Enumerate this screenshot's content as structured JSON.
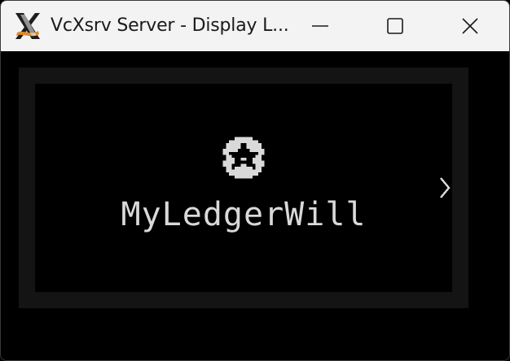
{
  "window": {
    "title": "VcXsrv Server - Display L...",
    "app_icon": "x-logo-icon",
    "controls": [
      "minimize-icon",
      "maximize-icon",
      "close-icon"
    ]
  },
  "device_screen": {
    "logo_icon": "star-badge-icon",
    "wordmark": "MyLedgerWill",
    "nav_icon": "chevron-right-icon"
  },
  "colors": {
    "titlebar": "#f3f3f3",
    "background": "#000000",
    "panel": "#141414",
    "text": "#d9d9d9"
  }
}
